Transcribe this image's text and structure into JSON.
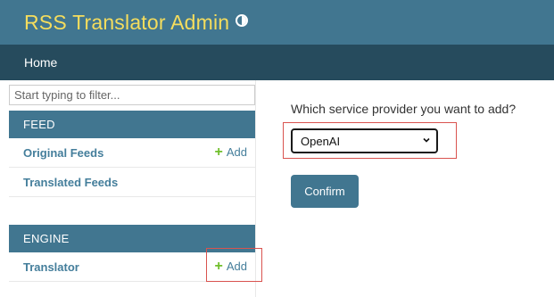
{
  "header": {
    "title": "RSS Translator Admin",
    "theme_toggle_icon": "contrast-icon"
  },
  "nav": {
    "home_label": "Home"
  },
  "sidebar": {
    "filter_placeholder": "Start typing to filter...",
    "sections": [
      {
        "title": "FEED",
        "items": [
          {
            "label": "Original Feeds",
            "add_label": "Add"
          },
          {
            "label": "Translated Feeds"
          }
        ]
      },
      {
        "title": "ENGINE",
        "items": [
          {
            "label": "Translator",
            "add_label": "Add"
          }
        ]
      }
    ]
  },
  "main": {
    "question": "Which service provider you want to add?",
    "provider_select": {
      "selected": "OpenAI"
    },
    "confirm_label": "Confirm"
  },
  "colors": {
    "header_bg": "#417690",
    "title": "#f5dd5d",
    "nav_bg": "#264b5d",
    "link": "#447e9b",
    "add_plus": "#70bf2b",
    "highlight_box": "#d9534f"
  }
}
